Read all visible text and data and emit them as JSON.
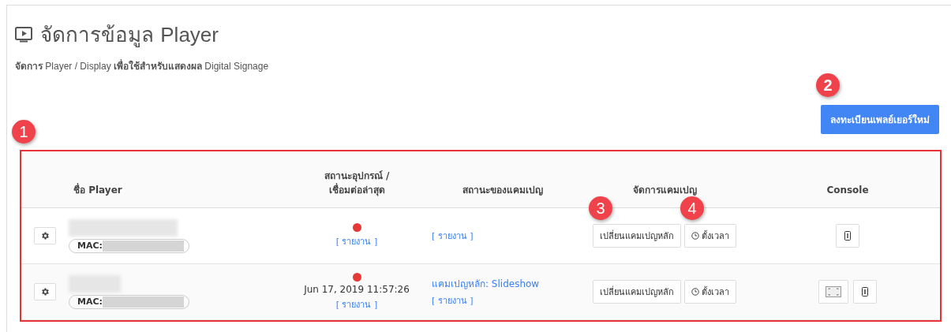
{
  "header": {
    "title_thai": "จัดการข้อมูล",
    "title_latin": "Player",
    "subtitle": "**จัดการ** Player / Display **เพื่อใช้สำหรับแสดงผล** Digital Signage"
  },
  "register_button": {
    "label": "ลงทะเบียนเพลย์เยอร์ใหม่",
    "callout": "2"
  },
  "table": {
    "callout": "1",
    "columns": [
      "ชื่อ Player",
      "สถานะอุปกรณ์ /\nเชื่อมต่อล่าสุด",
      "สถานะของแคมเปญ",
      "จัดการแคมเปญ",
      "Console"
    ],
    "rows": [
      {
        "mac_label": "MAC:",
        "color": "#e53935",
        "report_link": "[ รายงาน ]",
        "campaign_report": "[ รายงาน ]",
        "change_button": {
          "label": "เปลี่ยนแคมเปญหลัก",
          "callout": "3"
        },
        "schedule_button": {
          "label": "ตั้งเวลา",
          "callout": "4"
        },
        "console": [
          {
            "kind": "device"
          }
        ]
      },
      {
        "mac_label": "MAC:",
        "color": "#e53935",
        "last_seen": "Jun 17, 2019 11:57:26",
        "report_link": "[ รายงาน ]",
        "campaign": "แคมเปญหลัก: Slideshow",
        "campaign_report": "[ รายงาน ]",
        "change_button": {
          "label": "เปลี่ยนแคมเปญหลัก"
        },
        "schedule_button": {
          "label": "ตั้งเวลา"
        },
        "console": [
          {
            "kind": "screen"
          },
          {
            "kind": "device"
          }
        ]
      }
    ]
  }
}
